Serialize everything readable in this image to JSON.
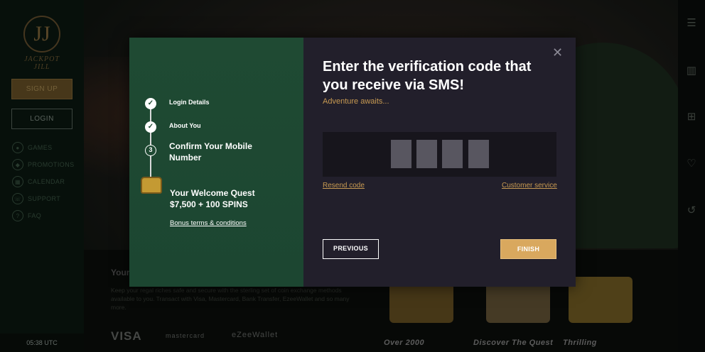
{
  "brand": {
    "logo_letters": "JJ",
    "logo_word": "JACKPOT JILL"
  },
  "sidebar": {
    "signup_label": "SIGN UP",
    "login_label": "LOGIN",
    "items": [
      {
        "label": "GAMES",
        "icon": "coin-icon"
      },
      {
        "label": "PROMOTIONS",
        "icon": "diamond-icon"
      },
      {
        "label": "CALENDAR",
        "icon": "calendar-icon"
      },
      {
        "label": "SUPPORT",
        "icon": "support-icon"
      },
      {
        "label": "FAQ",
        "icon": "faq-icon"
      }
    ],
    "clock": "05:38 UTC"
  },
  "rightbar": {
    "icons": [
      "filters-icon",
      "map-icon",
      "gift-icon",
      "heart-icon",
      "history-icon"
    ]
  },
  "background_content": {
    "section_title": "Your",
    "section_text": "Keep your regal riches safe and secure with the sterling set of coin exchange methods available to you. Transact with Visa, Mastercard, Bank Transfer, EzeeWallet and so many more.",
    "payments": [
      "VISA",
      "mastercard",
      "eZeeWallet"
    ],
    "promos": [
      "Over 2000",
      "Discover The Quest",
      "Thrilling"
    ]
  },
  "modal": {
    "steps": [
      {
        "label": "Login Details",
        "state": "done"
      },
      {
        "label": "About You",
        "state": "done"
      },
      {
        "label": "Confirm Your Mobile Number",
        "state": "current",
        "number": "3"
      }
    ],
    "welcome": {
      "line1": "Your Welcome Quest",
      "line2": "$7,500 + 100 SPINS"
    },
    "bonus_link": "Bonus terms & conditions",
    "title": "Enter the verification code that you receive via SMS!",
    "subtitle": "Adventure awaits...",
    "code_digits": [
      "",
      "",
      "",
      ""
    ],
    "resend_link": "Resend code",
    "customer_service_link": "Customer service",
    "previous_label": "PREVIOUS",
    "finish_label": "FINISH",
    "close_glyph": "✕"
  },
  "colors": {
    "accent_gold": "#d9a85e",
    "left_panel_green": "#1f4a33",
    "right_panel": "#221f2b"
  }
}
